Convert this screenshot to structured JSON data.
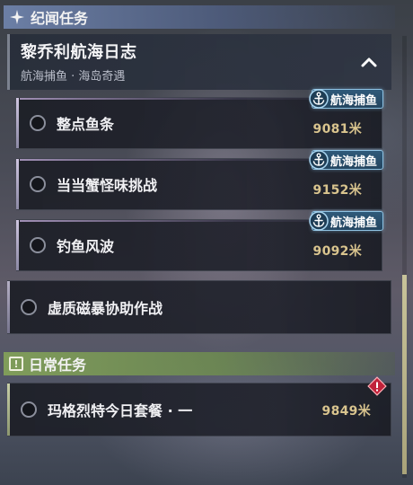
{
  "story_section": {
    "title": "纪闻任务",
    "icon": "sparkle-icon"
  },
  "chapter": {
    "title": "黎乔利航海日志",
    "subtitle": "航海捕鱼 · 海岛奇遇"
  },
  "story_quests": [
    {
      "name": "整点鱼条",
      "distance": "9081米",
      "badge": "航海捕鱼"
    },
    {
      "name": "当当蟹怪味挑战",
      "distance": "9152米",
      "badge": "航海捕鱼"
    },
    {
      "name": "钓鱼风波",
      "distance": "9092米",
      "badge": "航海捕鱼"
    }
  ],
  "standalone_quest": {
    "name": "虚质磁暴协助作战"
  },
  "daily_section": {
    "title": "日常任务",
    "icon": "exclamation-box-icon"
  },
  "daily_quest": {
    "name": "玛格烈特今日套餐 · 一",
    "distance": "9849米",
    "alert_icon": "alert-diamond-icon"
  },
  "colors": {
    "distance": "#d9c48e",
    "badge_bg": "#2f5a7a",
    "story_header": "#6e82aa",
    "daily_header": "#82a05a",
    "alert": "#c0223a"
  }
}
